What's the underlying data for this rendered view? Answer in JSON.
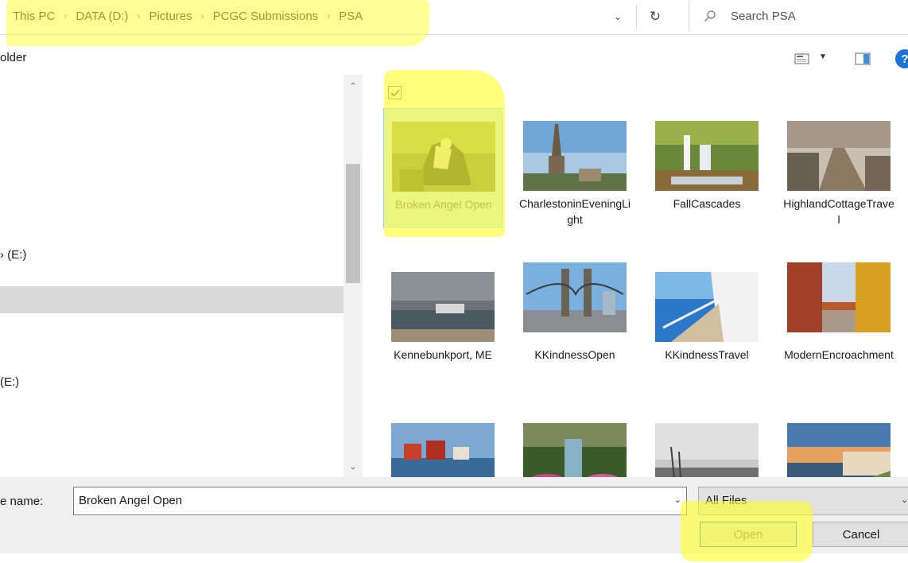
{
  "breadcrumb": {
    "items": [
      "This PC",
      "DATA (D:)",
      "Pictures",
      "PCGC Submissions",
      "PSA"
    ],
    "separator": "›"
  },
  "search": {
    "placeholder": "Search PSA"
  },
  "toolbar": {
    "new_folder_label": "older"
  },
  "nav": {
    "items": [
      {
        "label": "› (E:)"
      },
      {
        "label": "(E:)"
      }
    ]
  },
  "files": [
    {
      "name": "Broken Angel Open",
      "selected": true,
      "thumb": "angel-sculpture"
    },
    {
      "name": "CharlestoninEveningLight",
      "selected": false,
      "thumb": "church-steeple"
    },
    {
      "name": "FallCascades",
      "selected": false,
      "thumb": "waterfall"
    },
    {
      "name": "HighlandCottageTravel",
      "selected": false,
      "thumb": "stone-road"
    },
    {
      "name": "Kennebunkport, ME",
      "selected": false,
      "thumb": "stormy-coast"
    },
    {
      "name": "KKindnessOpen",
      "selected": false,
      "thumb": "suspension-bridge"
    },
    {
      "name": "KKindnessTravel",
      "selected": false,
      "thumb": "cruise-deck"
    },
    {
      "name": "ModernEncroachment",
      "selected": false,
      "thumb": "colorful-street"
    },
    {
      "name": "",
      "selected": false,
      "thumb": "harbor-houses"
    },
    {
      "name": "",
      "selected": false,
      "thumb": "garden-oaks"
    },
    {
      "name": "",
      "selected": false,
      "thumb": "bw-seaside"
    },
    {
      "name": "",
      "selected": false,
      "thumb": "sunset-shore"
    }
  ],
  "filename": {
    "label": "e name:",
    "value": "Broken Angel Open"
  },
  "filter": {
    "value": "All Files"
  },
  "buttons": {
    "open": "Open",
    "cancel": "Cancel"
  },
  "colors": {
    "highlight": "#ffff3c",
    "selection": "#cce8ff",
    "accent": "#0078d7",
    "help": "#1e73d9"
  }
}
